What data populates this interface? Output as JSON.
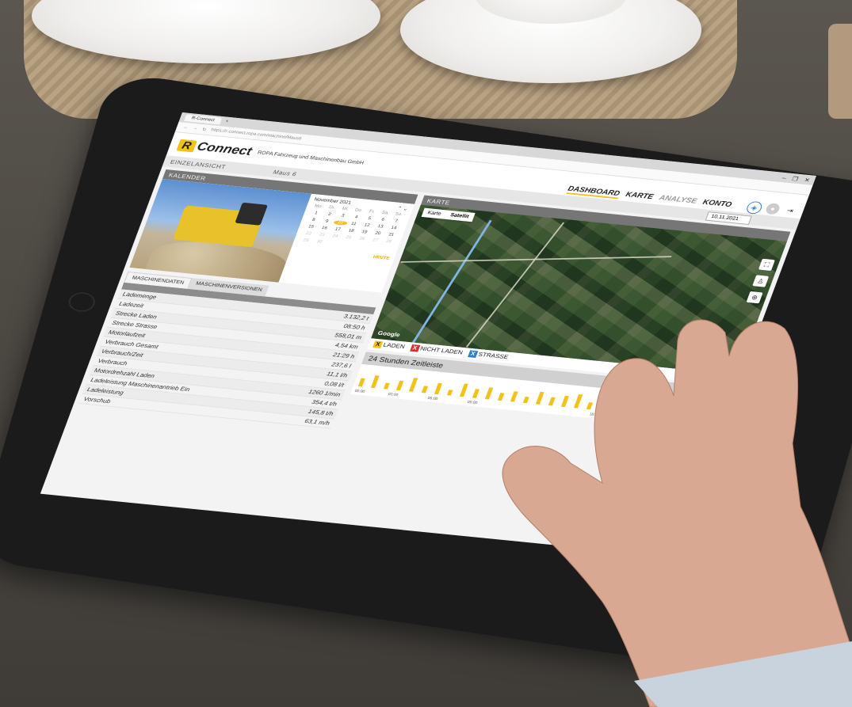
{
  "browser": {
    "tab_title": "R-Connect",
    "url": "https://r-connect.ropa.com/machine/Maus6"
  },
  "app": {
    "logo_letter": "R",
    "logo_word": "Connect",
    "company": "ROPA Fahrzeug und Maschinenbau GmbH",
    "nav": {
      "dashboard": "DASHBOARD",
      "karte": "KARTE",
      "analyse": "ANALYSE",
      "konto": "KONTO"
    },
    "brand_color": "#f2c21b"
  },
  "einzelansicht": {
    "label": "EINZELANSICHT",
    "machine": "Maus 6"
  },
  "kalender": {
    "title": "KALENDER",
    "month": "November 2021",
    "weekdays": [
      "Mo.",
      "Di.",
      "Mi.",
      "Do.",
      "Fr.",
      "Sa.",
      "So."
    ],
    "days": [
      "1",
      "2",
      "3",
      "4",
      "5",
      "6",
      "7",
      "8",
      "9",
      "10",
      "11",
      "12",
      "13",
      "14",
      "15",
      "16",
      "17",
      "18",
      "19",
      "20",
      "21",
      "22",
      "23",
      "24",
      "25",
      "26",
      "27",
      "28",
      "29",
      "30"
    ],
    "selected_day": "10",
    "today_button": "HEUTE"
  },
  "tabs": {
    "maschinendaten": "MASCHINENDATEN",
    "maschinenversionen": "MASCHINENVERSIONEN"
  },
  "maschinendaten": [
    {
      "label": "Lademenge",
      "value": "3.132,2 t"
    },
    {
      "label": "Ladezeit",
      "value": "08:50 h"
    },
    {
      "label": "Strecke Laden",
      "value": "558,01 m"
    },
    {
      "label": "Strecke Strasse",
      "value": "4,54 km"
    },
    {
      "label": "Motorlaufzeit",
      "value": "21:29 h"
    },
    {
      "label": "Verbrauch Gesamt",
      "value": "237,6 l"
    },
    {
      "label": "Verbrauch/Zeit",
      "value": "11,1 l/h"
    },
    {
      "label": "Verbrauch",
      "value": "0,08 l/t"
    },
    {
      "label": "Motordrehzahl Laden",
      "value": "1260 1/min"
    },
    {
      "label": "Ladeleistung Maschinenantrieb Ein",
      "value": "354,4 t/h"
    },
    {
      "label": "Ladeleistung",
      "value": "145,8 t/h"
    },
    {
      "label": "Vorschub",
      "value": "63,1 m/h"
    }
  ],
  "karte": {
    "title": "KARTE",
    "date": "10.11.2021",
    "map_toggle": [
      "Karte",
      "Satellit"
    ],
    "active_toggle": "Satellit",
    "attribution": "Google",
    "legend": [
      {
        "mark": "X",
        "label": "LADEN",
        "color": "#f2c21b"
      },
      {
        "mark": "X",
        "label": "NICHT LADEN",
        "color": "#d7302c"
      },
      {
        "mark": "X",
        "label": "STRASSE",
        "color": "#2e7fd3"
      }
    ]
  },
  "zeitleiste": {
    "title": "24 Stunden Zeitleiste",
    "labels": [
      "00:00",
      "03:00",
      "06:00",
      "09:00",
      "18:00"
    ]
  }
}
